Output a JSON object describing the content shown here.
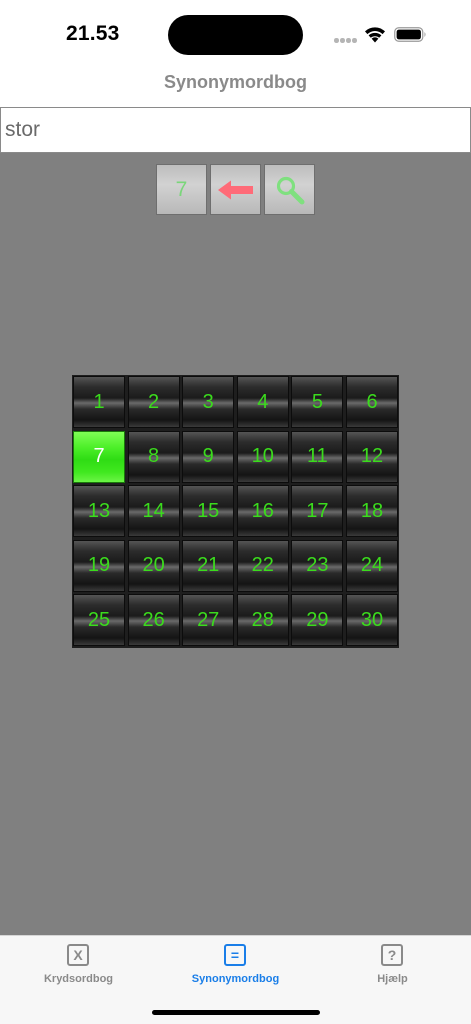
{
  "status": {
    "time": "21.53"
  },
  "header": {
    "title": "Synonymordbog"
  },
  "search": {
    "value": "stor",
    "placeholder": ""
  },
  "toolbar": {
    "letter_count": "7",
    "backspace_icon": "arrow-left-icon",
    "search_icon": "magnifier-icon",
    "backspace_color": "#ff6b78",
    "search_color": "#7fe07f"
  },
  "grid": {
    "columns": 6,
    "selected": "7",
    "cells": [
      "1",
      "2",
      "3",
      "4",
      "5",
      "6",
      "7",
      "8",
      "9",
      "10",
      "11",
      "12",
      "13",
      "14",
      "15",
      "16",
      "17",
      "18",
      "19",
      "20",
      "21",
      "22",
      "23",
      "24",
      "25",
      "26",
      "27",
      "28",
      "29",
      "30"
    ],
    "text_color": "#3bdb1d",
    "selected_color": "#4ef02a"
  },
  "tabs": [
    {
      "label": "Krydsordbog",
      "icon": "X",
      "active": false
    },
    {
      "label": "Synonymordbog",
      "icon": "=",
      "active": true
    },
    {
      "label": "Hjælp",
      "icon": "?",
      "active": false
    }
  ],
  "colors": {
    "accent": "#1a7ee8",
    "content_background": "#808080"
  }
}
